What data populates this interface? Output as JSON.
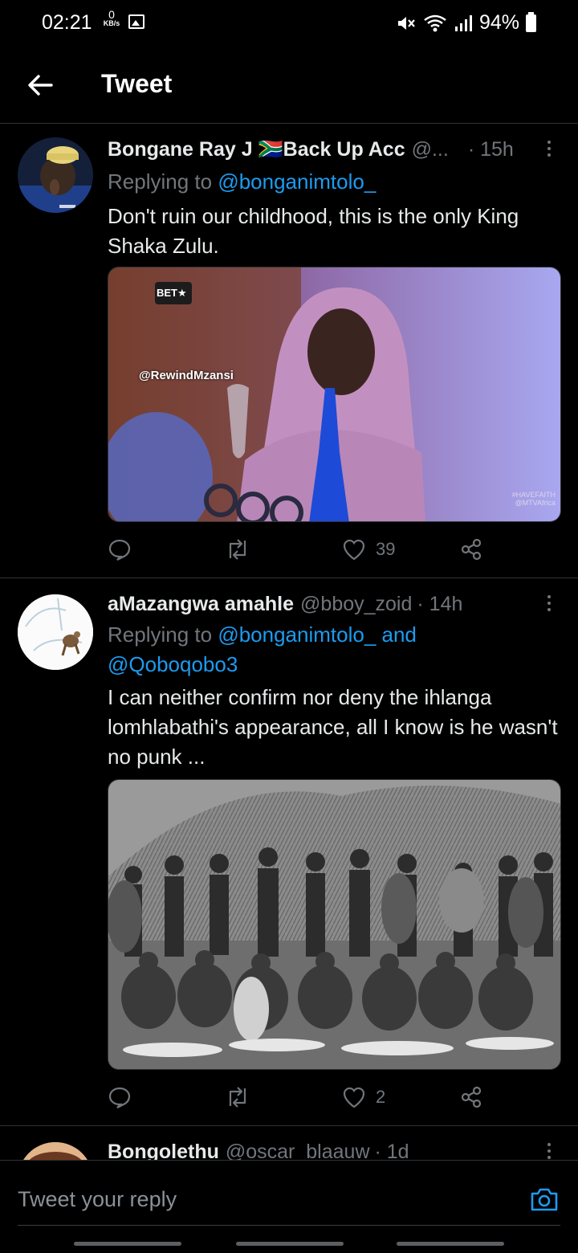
{
  "status_bar": {
    "time": "02:21",
    "net_speed_value": "0",
    "net_speed_unit": "KB/s",
    "battery": "94%"
  },
  "header": {
    "title": "Tweet"
  },
  "tweets": [
    {
      "name": "Bongane Ray J 🇿🇦Back Up Acc",
      "handle": "@...",
      "time": "· 15h",
      "replying_prefix": "Replying to",
      "replying_to": "@bonganimtolo_",
      "text": "Don't ruin our childhood, this is the only King Shaka Zulu.",
      "media_watermark": "@RewindMzansi",
      "media_logo": "BET★",
      "media_corner_tag": "#HAVEFAITH @MTVAfrica",
      "likes": "39"
    },
    {
      "name": "aMazangwa amahle",
      "handle": "@bboy_zoid",
      "time": "· 14h",
      "replying_prefix": "Replying to",
      "replying_to": "@bonganimtolo_ and @Qoboqobo3",
      "text": "I can neither confirm nor deny the ihlanga lomhlabathi's appearance, all I know is he wasn't no punk ...",
      "likes": "2"
    },
    {
      "name": "Bongolethu",
      "handle": "@oscar_blaauw",
      "time": "· 1d"
    }
  ],
  "reply_bar": {
    "placeholder": "Tweet your reply"
  },
  "colors": {
    "background": "#000000",
    "accent": "#1d9bf0",
    "secondary_text": "#71767b"
  }
}
